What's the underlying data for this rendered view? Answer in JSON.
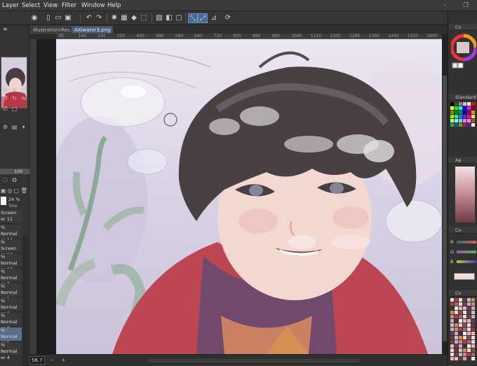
{
  "menu": [
    "Layer",
    "Select",
    "View",
    "Filter",
    "Window",
    "Help"
  ],
  "tabs": [
    "Illustration(Rec…",
    "AXiwater3.png"
  ],
  "ruler_labels": [
    "80",
    "160",
    "240",
    "320",
    "400",
    "480",
    "560",
    "640",
    "720",
    "800",
    "880",
    "960",
    "1040",
    "1120",
    "1200",
    "1280",
    "1360",
    "1440",
    "1520",
    "1600"
  ],
  "left": {
    "brush_size": "100",
    "opacity": "24 %",
    "tolerance": "Tole",
    "layers": [
      {
        "mode": "Screen",
        "name": "er 11"
      },
      {
        "mode": "% Normal",
        "name": "er 14"
      },
      {
        "mode": "% Screen",
        "name": "er 13"
      },
      {
        "mode": "% Normal",
        "name": "er 12"
      },
      {
        "mode": "% Normal",
        "name": "er 7"
      },
      {
        "mode": "% Normal",
        "name": "er 1 Copy"
      },
      {
        "mode": "% Normal",
        "name": "er 2"
      },
      {
        "mode": "% Normal",
        "name": "er 8"
      },
      {
        "mode": "% Normal",
        "name": "er 5"
      },
      {
        "mode": "% Normal",
        "name": "er 4"
      }
    ],
    "selected_layer_index": 8
  },
  "bottom": {
    "zoom": "56.7"
  },
  "right": {
    "color_panel": "Co",
    "swatch_panel": "Standard",
    "approx_panel": "Ap",
    "sub_panel": "Co",
    "rgb_labels": [
      "R",
      "G",
      "B"
    ],
    "history_panel": "Co"
  },
  "colors": {
    "accent": "#4a6a95",
    "selected_layer": "#5a6f8f"
  }
}
